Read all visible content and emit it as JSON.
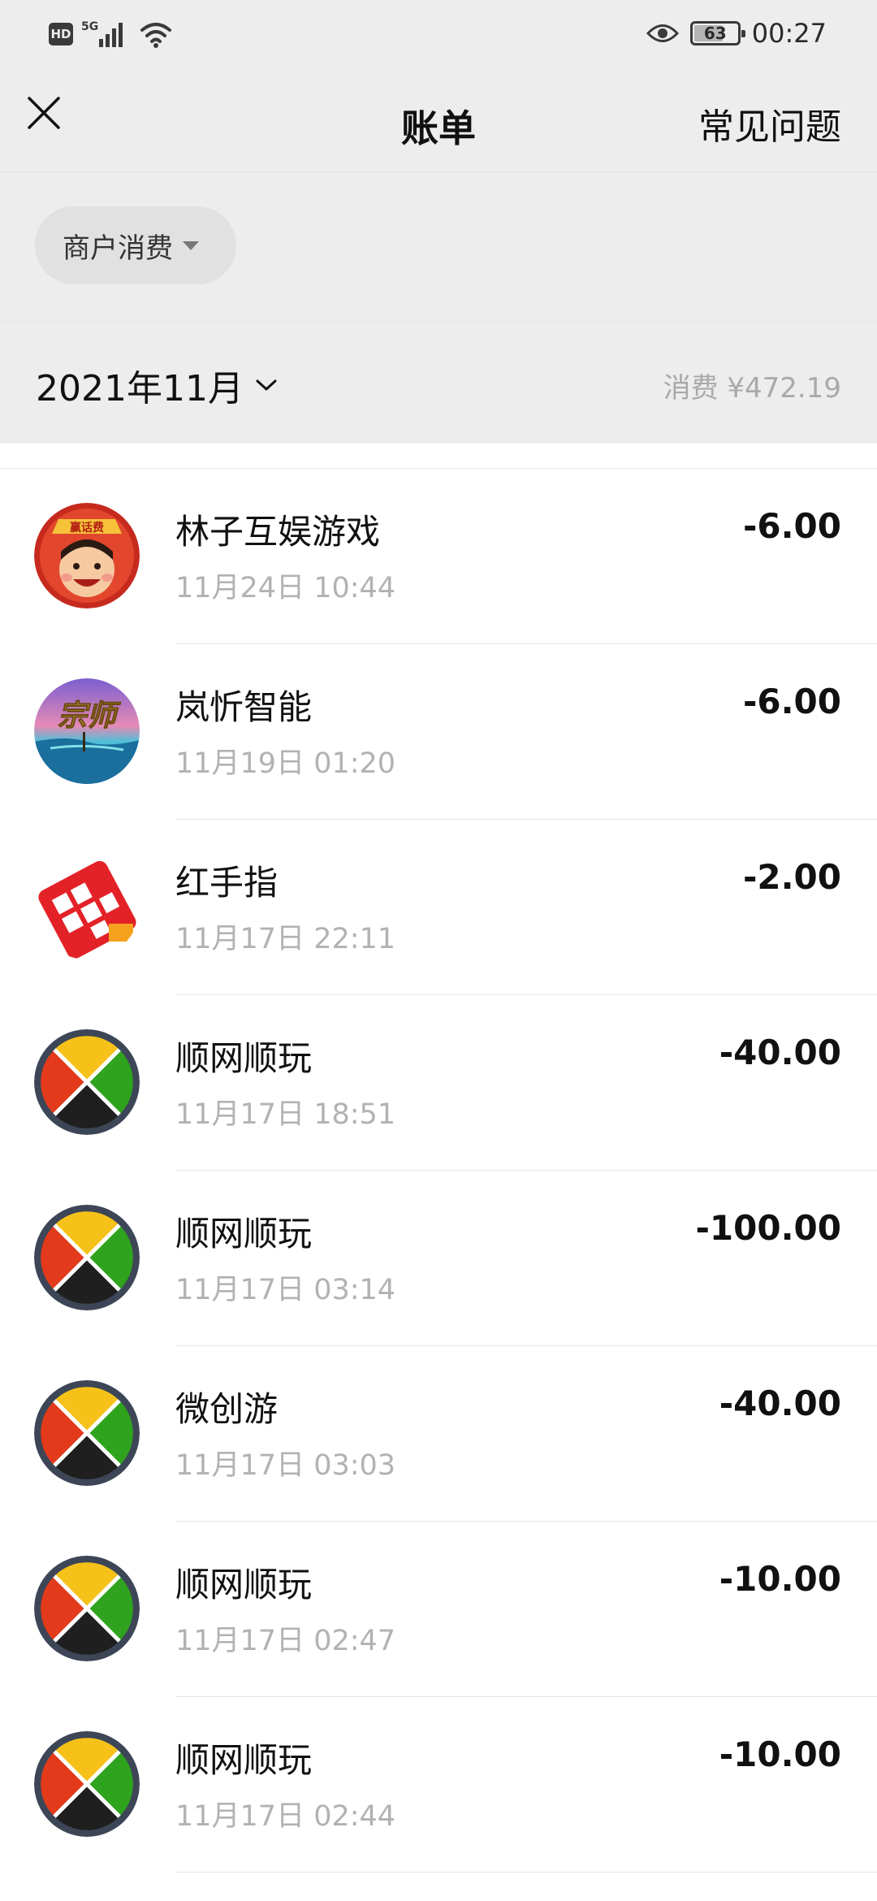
{
  "status_bar": {
    "hd_label": "HD",
    "network_label": "5G",
    "battery_level": "63",
    "time": "00:27"
  },
  "nav": {
    "title": "账单",
    "faq_label": "常见问题"
  },
  "filter": {
    "label": "商户消费"
  },
  "month": {
    "label": "2021年11月",
    "total": "消费 ¥472.19"
  },
  "transactions": [
    {
      "name": "林子互娱游戏",
      "time": "11月24日 10:44",
      "amount": "-6.00",
      "icon": "game-avatar-icon",
      "avatar_text": "赢话费"
    },
    {
      "name": "岚忻智能",
      "time": "11月19日 01:20",
      "amount": "-6.00",
      "icon": "seascape-avatar-icon",
      "avatar_text": "宗师"
    },
    {
      "name": "红手指",
      "time": "11月17日 22:11",
      "amount": "-2.00",
      "icon": "red-finger-icon"
    },
    {
      "name": "顺网顺玩",
      "time": "11月17日 18:51",
      "amount": "-40.00",
      "icon": "shunwang-icon"
    },
    {
      "name": "顺网顺玩",
      "time": "11月17日 03:14",
      "amount": "-100.00",
      "icon": "shunwang-icon"
    },
    {
      "name": "微创游",
      "time": "11月17日 03:03",
      "amount": "-40.00",
      "icon": "shunwang-icon"
    },
    {
      "name": "顺网顺玩",
      "time": "11月17日 02:47",
      "amount": "-10.00",
      "icon": "shunwang-icon"
    },
    {
      "name": "顺网顺玩",
      "time": "11月17日 02:44",
      "amount": "-10.00",
      "icon": "shunwang-icon"
    }
  ],
  "colors": {
    "header_bg": "#ededed",
    "chip_bg": "#e1e1e1",
    "divider": "#e5e5e5",
    "secondary_text": "#b2b2b2"
  }
}
